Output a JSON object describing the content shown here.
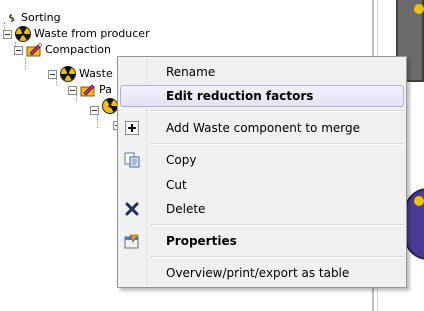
{
  "tree": {
    "nodes": [
      {
        "label": "Sorting"
      },
      {
        "label": "Waste from producer"
      },
      {
        "label": "Compaction"
      },
      {
        "label": "Waste"
      },
      {
        "label": "Pa"
      }
    ]
  },
  "context_menu": {
    "items": [
      {
        "label": "Rename"
      },
      {
        "label": "Edit reduction factors"
      },
      {
        "label": "Add Waste component to merge",
        "icon": "plus-icon"
      },
      {
        "label": "Copy",
        "icon": "copy-icon"
      },
      {
        "label": "Cut"
      },
      {
        "label": "Delete",
        "icon": "delete-x-icon"
      },
      {
        "label": "Properties",
        "icon": "properties-icon"
      },
      {
        "label": "Overview/print/export as table"
      }
    ]
  },
  "colors": {
    "menu_background": "#f0f0f0",
    "highlight_border": "#b8abd9",
    "selection": "#3399ff",
    "radiation_yellow": "#f2c200",
    "delete_blue": "#1d2f6b"
  }
}
